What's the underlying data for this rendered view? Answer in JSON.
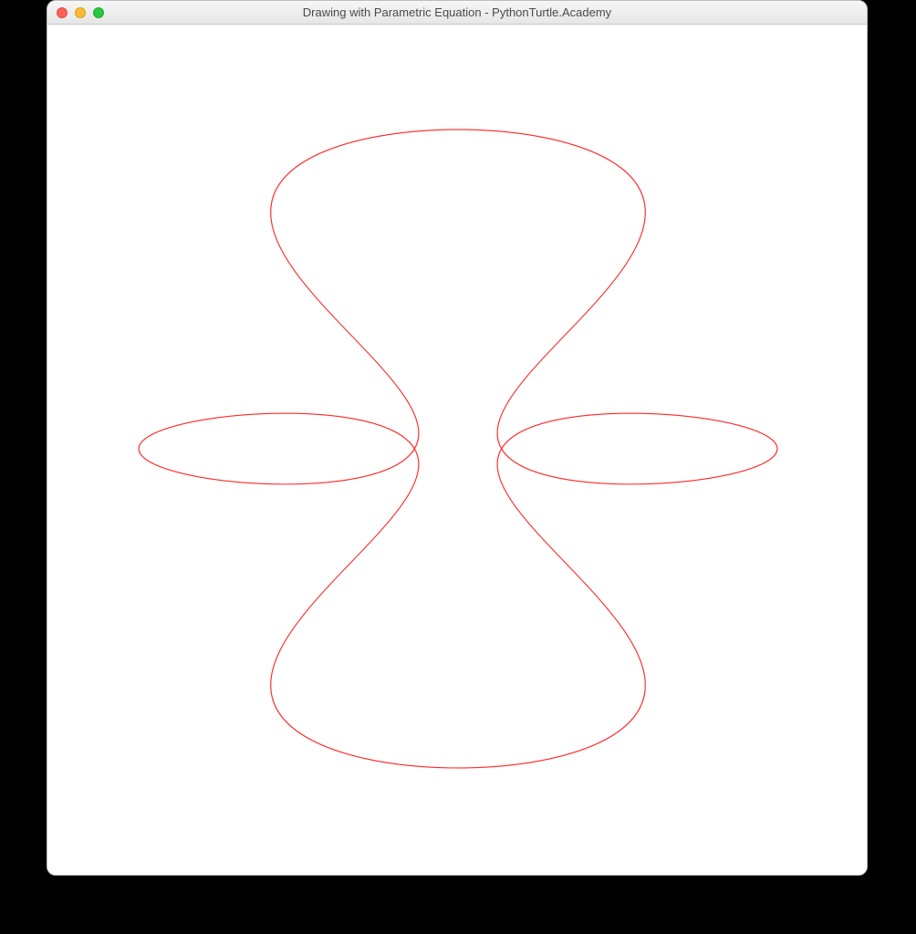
{
  "window": {
    "title": "Drawing with Parametric Equation - PythonTurtle.Academy"
  },
  "chart_data": {
    "type": "line",
    "title": "",
    "xlabel": "",
    "ylabel": "",
    "description": "Parametric curve (spirograph / Lissajous-style figure with four-fold rotational symmetry)",
    "stroke_color": "#ff2a2a",
    "stroke_width": 1,
    "background": "#ffffff",
    "center": [
      450,
      465
    ],
    "scale": 350,
    "equation": {
      "x": "cos(a*t) + 0.6*cos(b*t)",
      "y": "sin(a*t) + 0.6*sin(c*t)"
    },
    "params": {
      "a": 1,
      "b": 5,
      "c": -3,
      "amp2": 0.6
    },
    "t_range": [
      0,
      1000
    ],
    "t_step": 0.02,
    "lobes": 4
  }
}
